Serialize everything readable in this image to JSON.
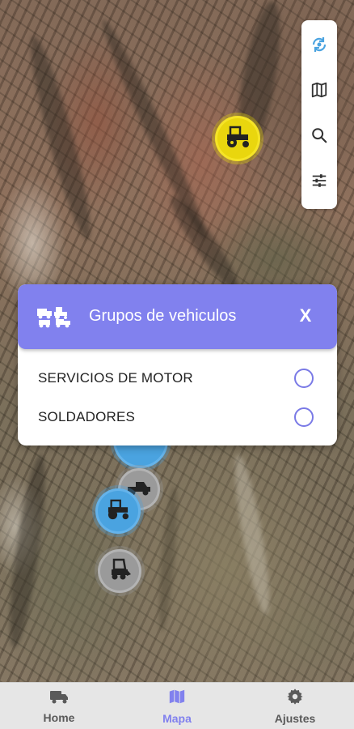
{
  "map_controls": {
    "refresh": "refresh-icon",
    "layers": "map-icon",
    "search": "search-icon",
    "filters": "sliders-icon"
  },
  "markers": [
    {
      "color": "yellow",
      "vehicle": "tractor-icon"
    },
    {
      "color": "blue",
      "vehicle": "vehicle-icon"
    },
    {
      "color": "gray",
      "vehicle": "pickup-icon"
    },
    {
      "color": "blue",
      "vehicle": "tractor-icon"
    },
    {
      "color": "gray",
      "vehicle": "skid-steer-icon"
    }
  ],
  "groups_modal": {
    "title": "Grupos de vehiculos",
    "close_label": "X",
    "groups": [
      {
        "label": "SERVICIOS DE MOTOR",
        "selected": false
      },
      {
        "label": "SOLDADORES",
        "selected": false
      }
    ]
  },
  "bottom_nav": {
    "items": [
      {
        "label": "Home",
        "icon": "truck-icon",
        "active": false
      },
      {
        "label": "Mapa",
        "icon": "map-icon",
        "active": true
      },
      {
        "label": "Ajustes",
        "icon": "gear-icon",
        "active": false
      }
    ]
  },
  "colors": {
    "accent": "#8181ee",
    "marker_yellow": "#e9d60e",
    "marker_blue": "#4aa3e0",
    "marker_gray": "#9a9a9a",
    "nav_bg": "#e6e6e6"
  }
}
